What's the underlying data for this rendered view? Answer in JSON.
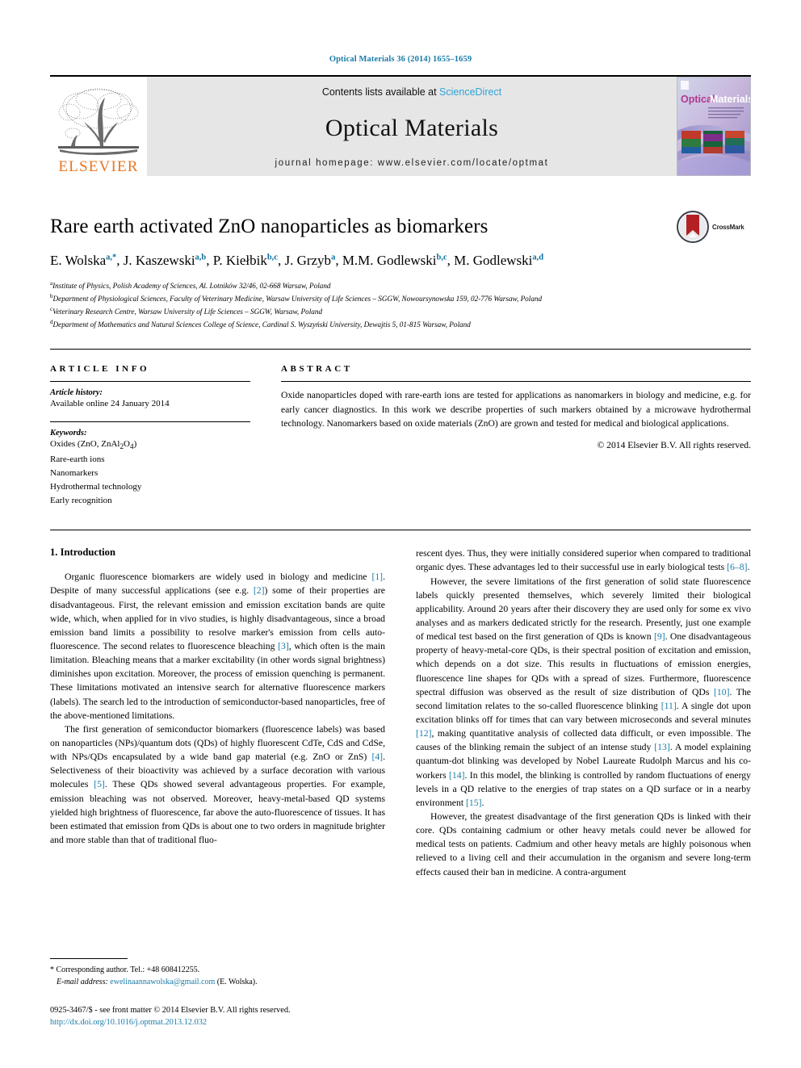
{
  "running_head": "Optical Materials 36 (2014) 1655–1659",
  "masthead": {
    "contents_prefix": "Contents lists available at ",
    "sciencedirect": "ScienceDirect",
    "journal_title": "Optical Materials",
    "homepage": "journal homepage: www.elsevier.com/locate/optmat",
    "publisher": "ELSEVIER",
    "cover_title_1": "Optical",
    "cover_title_2": "Materials"
  },
  "article": {
    "title": "Rare earth activated ZnO nanoparticles as biomarkers",
    "crossmark_label": "CrossMark",
    "authors": [
      {
        "name": "E. Wolska",
        "sup": "a,*"
      },
      {
        "name": "J. Kaszewski",
        "sup": "a,b"
      },
      {
        "name": "P. Kiełbik",
        "sup": "b,c"
      },
      {
        "name": "J. Grzyb",
        "sup": "a"
      },
      {
        "name": "M.M. Godlewski",
        "sup": "b,c"
      },
      {
        "name": "M. Godlewski",
        "sup": "a,d"
      }
    ],
    "affiliations": [
      {
        "mark": "a",
        "text": "Institute of Physics, Polish Academy of Sciences, Al. Lotników 32/46, 02-668 Warsaw, Poland"
      },
      {
        "mark": "b",
        "text": "Department of Physiological Sciences, Faculty of Veterinary Medicine, Warsaw University of Life Sciences – SGGW, Nowoursynowska 159, 02-776 Warsaw, Poland"
      },
      {
        "mark": "c",
        "text": "Veterinary Research Centre, Warsaw University of Life Sciences – SGGW, Warsaw, Poland"
      },
      {
        "mark": "d",
        "text": "Department of Mathematics and Natural Sciences College of Science, Cardinal S. Wyszyński University, Dewajtis 5, 01-815 Warsaw, Poland"
      }
    ]
  },
  "info": {
    "heading": "ARTICLE INFO",
    "history_label": "Article history:",
    "history_value": "Available online 24 January 2014",
    "keywords_label": "Keywords:",
    "keywords": [
      "Oxides (ZnO, ZnAl2O4)",
      "Rare-earth ions",
      "Nanomarkers",
      "Hydrothermal technology",
      "Early recognition"
    ]
  },
  "abstract": {
    "heading": "ABSTRACT",
    "text": "Oxide nanoparticles doped with rare-earth ions are tested for applications as nanomarkers in biology and medicine, e.g. for early cancer diagnostics. In this work we describe properties of such markers obtained by a microwave hydrothermal technology. Nanomarkers based on oxide materials (ZnO) are grown and tested for medical and biological applications.",
    "copyright": "© 2014 Elsevier B.V. All rights reserved."
  },
  "body": {
    "section_title": "1. Introduction",
    "left_paragraphs": [
      "Organic fluorescence biomarkers are widely used in biology and medicine [1]. Despite of many successful applications (see e.g. [2]) some of their properties are disadvantageous. First, the relevant emission and emission excitation bands are quite wide, which, when applied for in vivo studies, is highly disadvantageous, since a broad emission band limits a possibility to resolve marker's emission from cells auto-fluorescence. The second relates to fluorescence bleaching [3], which often is the main limitation. Bleaching means that a marker excitability (in other words signal brightness) diminishes upon excitation. Moreover, the process of emission quenching is permanent. These limitations motivated an intensive search for alternative fluorescence markers (labels). The search led to the introduction of semiconductor-based nanoparticles, free of the above-mentioned limitations.",
      "The first generation of semiconductor biomarkers (fluorescence labels) was based on nanoparticles (NPs)/quantum dots (QDs) of highly fluorescent CdTe, CdS and CdSe, with NPs/QDs encapsulated by a wide band gap material (e.g. ZnO or ZnS) [4]. Selectiveness of their bioactivity was achieved by a surface decoration with various molecules [5]. These QDs showed several advantageous properties. For example, emission bleaching was not observed. Moreover, heavy-metal-based QD systems yielded high brightness of fluorescence, far above the auto-fluorescence of tissues. It has been estimated that emission from QDs is about one to two orders in magnitude brighter and more stable than that of traditional fluo-"
    ],
    "right_paragraphs": [
      "rescent dyes. Thus, they were initially considered superior when compared to traditional organic dyes. These advantages led to their successful use in early biological tests [6–8].",
      "However, the severe limitations of the first generation of solid state fluorescence labels quickly presented themselves, which severely limited their biological applicability. Around 20 years after their discovery they are used only for some ex vivo analyses and as markers dedicated strictly for the research. Presently, just one example of medical test based on the first generation of QDs is known [9]. One disadvantageous property of heavy-metal-core QDs, is their spectral position of excitation and emission, which depends on a dot size. This results in fluctuations of emission energies, fluorescence line shapes for QDs with a spread of sizes. Furthermore, fluorescence spectral diffusion was observed as the result of size distribution of QDs [10]. The second limitation relates to the so-called fluorescence blinking [11]. A single dot upon excitation blinks off for times that can vary between microseconds and several minutes [12], making quantitative analysis of collected data difficult, or even impossible. The causes of the blinking remain the subject of an intense study [13]. A model explaining quantum-dot blinking was developed by Nobel Laureate Rudolph Marcus and his co-workers [14]. In this model, the blinking is controlled by random fluctuations of energy levels in a QD relative to the energies of trap states on a QD surface or in a nearby environment [15].",
      "However, the greatest disadvantage of the first generation QDs is linked with their core. QDs containing cadmium or other heavy metals could never be allowed for medical tests on patients. Cadmium and other heavy metals are highly poisonous when relieved to a living cell and their accumulation in the organism and severe long-term effects caused their ban in medicine. A contra-argument"
    ]
  },
  "footnote": {
    "corresponding": "* Corresponding author. Tel.: +48 608412255.",
    "email_label": "E-mail address:",
    "email": "ewelinaannawolska@gmail.com",
    "email_owner": "(E. Wolska).",
    "issn_line": "0925-3467/$ - see front matter © 2014 Elsevier B.V. All rights reserved.",
    "doi": "http://dx.doi.org/10.1016/j.optmat.2013.12.032"
  },
  "colors": {
    "link": "#1a7ba8",
    "sciencedirect": "#2fa3d6",
    "elsevier_orange": "#E87722",
    "sup_blue": "#0b6e9e"
  }
}
